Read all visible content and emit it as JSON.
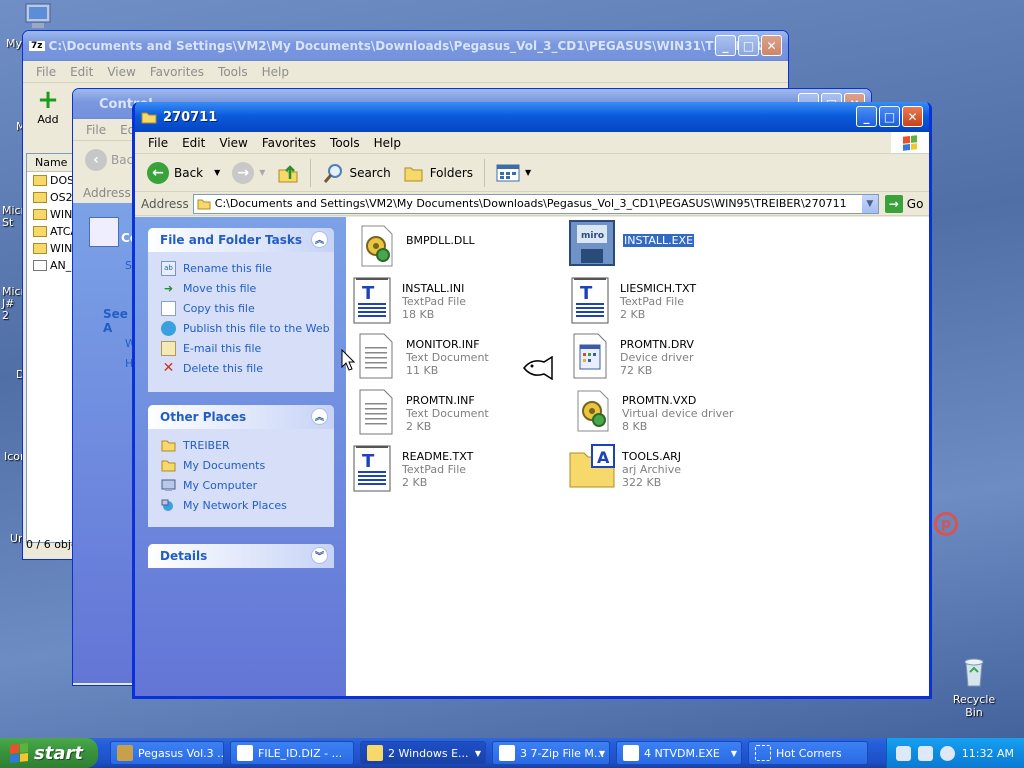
{
  "desktop": {
    "icon_labels": [
      "My",
      "My",
      "Micro St",
      "Micro J# 2",
      "D",
      "Icon",
      "Un"
    ],
    "recycle_bin_label": "Recycle Bin"
  },
  "back_window_1": {
    "title": "C:\\Documents and Settings\\VM2\\My Documents\\Downloads\\Pegasus_Vol_3_CD1\\PEGASUS\\WIN31\\TREIBER...",
    "menu": [
      "File",
      "Edit",
      "View",
      "Favorites",
      "Tools",
      "Help"
    ],
    "add_label": "Add",
    "column_name": "Name",
    "rows": [
      "DOS",
      "OS2",
      "WIN9",
      "ATCA",
      "WIN3",
      "AN_I"
    ],
    "status": "0 / 6 obje"
  },
  "back_window_2": {
    "title": "Control",
    "menu": [
      "File",
      "Edi"
    ],
    "back_label": "Bac",
    "address_label": "Address",
    "task_heading": "Co",
    "task_item": "S",
    "see_also_heading": "See A",
    "see_also_items": [
      "W",
      "H"
    ]
  },
  "main_window": {
    "title": "270711",
    "menu": [
      "File",
      "Edit",
      "View",
      "Favorites",
      "Tools",
      "Help"
    ],
    "toolbar": {
      "back": "Back",
      "search": "Search",
      "folders": "Folders"
    },
    "address_label": "Address",
    "address_value": "C:\\Documents and Settings\\VM2\\My Documents\\Downloads\\Pegasus_Vol_3_CD1\\PEGASUS\\WIN95\\TREIBER\\270711",
    "go_label": "Go",
    "file_tasks": {
      "heading": "File and Folder Tasks",
      "items": [
        "Rename this file",
        "Move this file",
        "Copy this file",
        "Publish this file to the Web",
        "E-mail this file",
        "Delete this file"
      ]
    },
    "other_places": {
      "heading": "Other Places",
      "items": [
        "TREIBER",
        "My Documents",
        "My Computer",
        "My Network Places"
      ]
    },
    "details": {
      "heading": "Details"
    },
    "files": [
      {
        "name": "BMPDLL.DLL",
        "type": "",
        "size": ""
      },
      {
        "name": "INSTALL.EXE",
        "type": "",
        "size": ""
      },
      {
        "name": "INSTALL.INI",
        "type": "TextPad File",
        "size": "18 KB"
      },
      {
        "name": "LIESMICH.TXT",
        "type": "TextPad File",
        "size": "2 KB"
      },
      {
        "name": "MONITOR.INF",
        "type": "Text Document",
        "size": "11 KB"
      },
      {
        "name": "PROMTN.DRV",
        "type": "Device driver",
        "size": "72 KB"
      },
      {
        "name": "PROMTN.INF",
        "type": "Text Document",
        "size": "2 KB"
      },
      {
        "name": "PROMTN.VXD",
        "type": "Virtual device driver",
        "size": "8 KB"
      },
      {
        "name": "README.TXT",
        "type": "TextPad File",
        "size": "2 KB"
      },
      {
        "name": "TOOLS.ARJ",
        "type": "arj Archive",
        "size": "322 KB"
      }
    ],
    "selected_file": "INSTALL.EXE",
    "selection_color": "#316ac5"
  },
  "taskbar": {
    "start_label": "start",
    "tasks": [
      {
        "label": "Pegasus Vol.3 ..."
      },
      {
        "label": "FILE_ID.DIZ - ..."
      },
      {
        "label": "2 Windows E..."
      },
      {
        "label": "3 7-Zip File M..."
      },
      {
        "label": "4 NTVDM.EXE"
      },
      {
        "label": "Hot Corners"
      }
    ],
    "clock": "11:32 AM"
  }
}
